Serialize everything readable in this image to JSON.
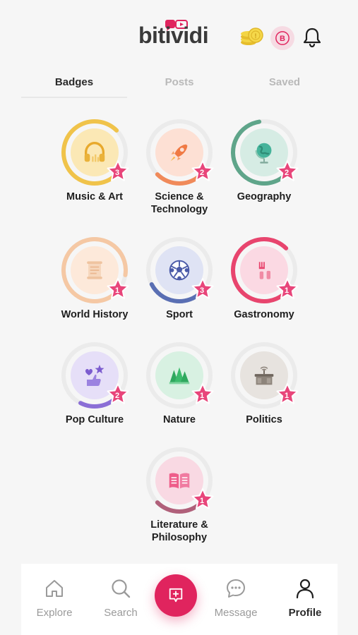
{
  "header": {
    "logo_text": "bitividi",
    "profile_badge_letter": "B"
  },
  "tabs": [
    {
      "label": "Badges",
      "active": true
    },
    {
      "label": "Posts",
      "active": false
    },
    {
      "label": "Saved",
      "active": false
    }
  ],
  "badges": [
    {
      "label": "Music & Art",
      "level": "3",
      "icon": "headphones-icon",
      "progress": 0.75,
      "ring_color": "#f0c34a",
      "inner_color": "#fbe8b5"
    },
    {
      "label": "Science & Technology",
      "level": "2",
      "icon": "rocket-icon",
      "progress": 0.25,
      "ring_color": "#f08a5a",
      "inner_color": "#fde0d4"
    },
    {
      "label": "Geography",
      "level": "2",
      "icon": "globe-icon",
      "progress": 0.6,
      "ring_color": "#5fa58a",
      "inner_color": "#d6ece4"
    },
    {
      "label": "World History",
      "level": "1",
      "icon": "scroll-icon",
      "progress": 0.9,
      "ring_color": "#f5c8a4",
      "inner_color": "#fde9da"
    },
    {
      "label": "Sport",
      "level": "3",
      "icon": "soccer-ball-icon",
      "progress": 0.3,
      "ring_color": "#5a6fb3",
      "inner_color": "#dfe3f4"
    },
    {
      "label": "Gastronomy",
      "level": "1",
      "icon": "cutlery-icon",
      "progress": 0.75,
      "ring_color": "#e8456e",
      "inner_color": "#fbd9e3"
    },
    {
      "label": "Pop Culture",
      "level": "2",
      "icon": "like-hearts-icon",
      "progress": 0.2,
      "ring_color": "#8b6fd6",
      "inner_color": "#e6dff8"
    },
    {
      "label": "Nature",
      "level": "1",
      "icon": "trees-icon",
      "progress": 0.0,
      "ring_color": "#48b474",
      "inner_color": "#d8f1e2"
    },
    {
      "label": "Politics",
      "level": "1",
      "icon": "podium-icon",
      "progress": 0.0,
      "ring_color": "#8a8075",
      "inner_color": "#e7e3df"
    },
    {
      "label": "Literature & Philosophy",
      "level": "1",
      "icon": "open-book-icon",
      "progress": 0.25,
      "ring_color": "#b0607a",
      "inner_color": "#f9d9e3"
    }
  ],
  "nav": [
    {
      "label": "Explore",
      "icon": "home-icon",
      "active": false
    },
    {
      "label": "Search",
      "icon": "search-icon",
      "active": false
    },
    {
      "label": "Message",
      "icon": "message-icon",
      "active": false
    },
    {
      "label": "Profile",
      "icon": "profile-icon",
      "active": true
    }
  ],
  "colors": {
    "accent": "#e0245e",
    "background": "#f6f6f6",
    "star": "#e8457a"
  }
}
